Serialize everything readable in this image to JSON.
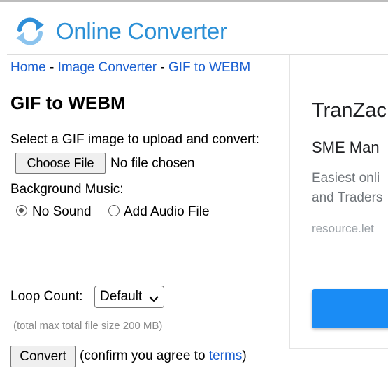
{
  "site": {
    "name": "Online Converter",
    "accent": "#2a8fd6",
    "link_color": "#1a5fd1"
  },
  "breadcrumb": {
    "home": "Home",
    "sep1": " - ",
    "category": "Image Converter",
    "sep2": " - ",
    "current": "GIF to WEBM"
  },
  "page": {
    "title": "GIF to WEBM"
  },
  "upload": {
    "label": "Select a GIF image to upload and convert:",
    "button_label": "Choose File",
    "status": "No file chosen"
  },
  "music": {
    "label": "Background Music:",
    "options": [
      {
        "label": "No Sound",
        "checked": true
      },
      {
        "label": "Add Audio File",
        "checked": false
      }
    ]
  },
  "loop": {
    "label": "Loop Count:",
    "selected": "Default"
  },
  "size_note": "(total max total file size 200 MB)",
  "convert": {
    "button_label": "Convert",
    "confirm_prefix": "(confirm you agree to ",
    "terms_link": "terms",
    "confirm_suffix": ")"
  },
  "ad": {
    "title": "TranZac",
    "subtitle": "SME Man",
    "desc_line1": "Easiest onli",
    "desc_line2": "and Traders",
    "url": "resource.let",
    "cta_color": "#1a8cf5"
  }
}
